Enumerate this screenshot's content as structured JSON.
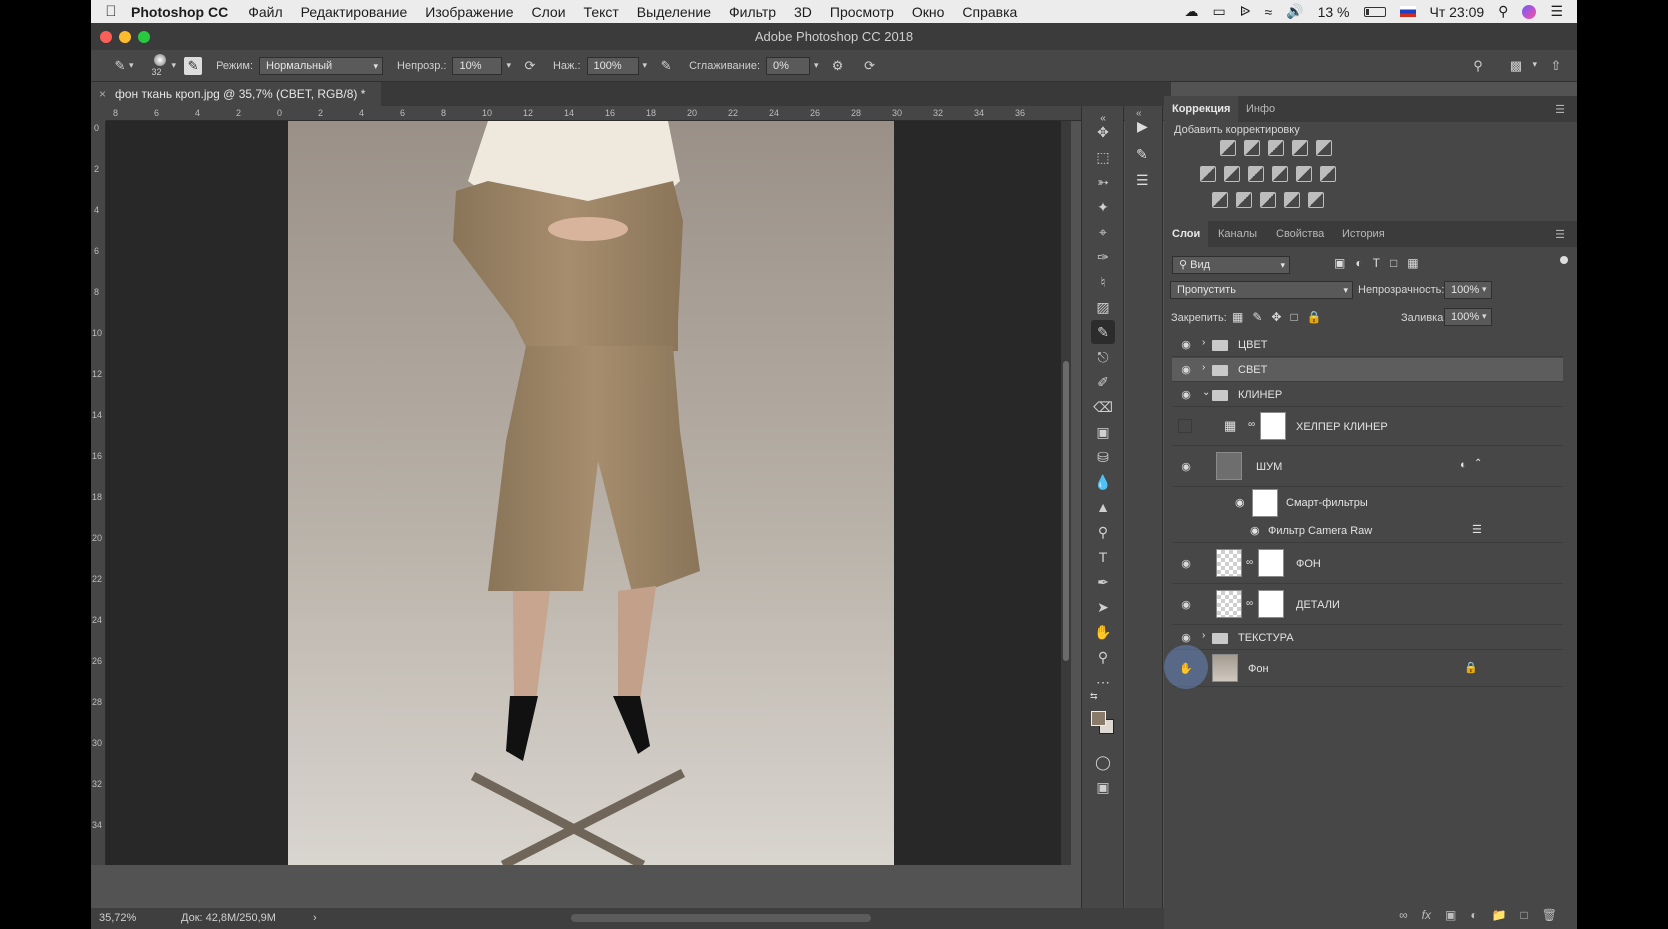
{
  "menubar": {
    "app_name": "Photoshop CC",
    "items": [
      "Файл",
      "Редактирование",
      "Изображение",
      "Слои",
      "Текст",
      "Выделение",
      "Фильтр",
      "3D",
      "Просмотр",
      "Окно",
      "Справка"
    ],
    "battery": "13 %",
    "clock": "Чт 23:09"
  },
  "window": {
    "title": "Adobe Photoshop CC 2018"
  },
  "options": {
    "brush_size": "32",
    "mode_label": "Режим:",
    "mode_value": "Нормальный",
    "opacity_label": "Непрозр.:",
    "opacity_value": "10%",
    "pressure_label": "Наж.:",
    "pressure_value": "100%",
    "smoothing_label": "Сглаживание:",
    "smoothing_value": "0%"
  },
  "document": {
    "tab_title": "фон ткань кроп.jpg @ 35,7% (СВЕТ, RGB/8) *"
  },
  "rulers": {
    "h_ticks": [
      "8",
      "6",
      "4",
      "2",
      "0",
      "2",
      "4",
      "6",
      "8",
      "10",
      "12",
      "14",
      "16",
      "18",
      "20",
      "22",
      "24",
      "26",
      "28",
      "30",
      "32",
      "34",
      "36"
    ],
    "v_ticks": [
      "0",
      "2",
      "4",
      "6",
      "8",
      "10",
      "12",
      "14",
      "16",
      "18",
      "20",
      "22",
      "24",
      "26",
      "28",
      "30",
      "32",
      "34"
    ]
  },
  "status": {
    "zoom": "35,72%",
    "doc_size": "Док: 42,8M/250,9M"
  },
  "correction_panel": {
    "tab_correction": "Коррекция",
    "tab_info": "Инфо",
    "add_label": "Добавить корректировку"
  },
  "layers_panel": {
    "tabs": [
      "Слои",
      "Каналы",
      "Свойства",
      "История"
    ],
    "filter_kind": "Вид",
    "blend_mode": "Пропустить",
    "opacity_label": "Непрозрачность:",
    "opacity_value": "100%",
    "lock_label": "Закрепить:",
    "fill_label": "Заливка:",
    "fill_value": "100%",
    "layers": [
      {
        "name": "ЦВЕТ"
      },
      {
        "name": "СВЕТ"
      },
      {
        "name": "КЛИНЕР"
      },
      {
        "name": "ХЕЛПЕР КЛИНЕР"
      },
      {
        "name": "ШУМ"
      },
      {
        "name": "Смарт-фильтры"
      },
      {
        "name": "Фильтр Camera Raw"
      },
      {
        "name": "ФОН"
      },
      {
        "name": "ДЕТАЛИ"
      },
      {
        "name": "ТЕКСТУРА"
      },
      {
        "name": "Фон"
      }
    ]
  }
}
